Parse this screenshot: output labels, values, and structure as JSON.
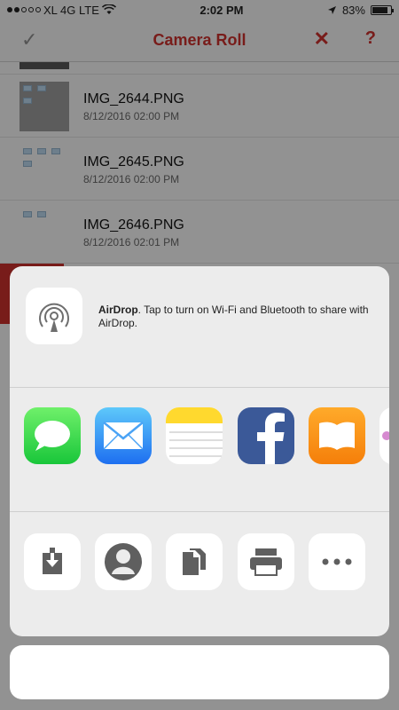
{
  "status_bar": {
    "carrier": "XL 4G LTE",
    "time": "2:02 PM",
    "battery": "83%",
    "battery_level": 0.83
  },
  "nav": {
    "title": "Camera Roll",
    "left_icon": "checkmark-icon",
    "close_icon": "close-icon",
    "help_label": "?"
  },
  "files": [
    {
      "name": "IMG_2644.PNG",
      "date": "8/12/2016 02:00 PM"
    },
    {
      "name": "IMG_2645.PNG",
      "date": "8/12/2016 02:00 PM"
    },
    {
      "name": "IMG_2646.PNG",
      "date": "8/12/2016 02:01 PM"
    }
  ],
  "share_sheet": {
    "airdrop": {
      "title": "AirDrop",
      "message": ". Tap to turn on Wi-Fi and Bluetooth to share with AirDrop."
    },
    "apps": [
      {
        "icon": "messages-icon",
        "color": "#25d04a"
      },
      {
        "icon": "mail-icon",
        "color": "#2a8ff2"
      },
      {
        "icon": "notes-icon",
        "color": "#ffd92e"
      },
      {
        "icon": "facebook-icon",
        "color": "#3b5998"
      },
      {
        "icon": "ibooks-icon",
        "color": "#f58a14"
      }
    ],
    "actions": [
      {
        "icon": "save-to-files-icon"
      },
      {
        "icon": "contact-icon"
      },
      {
        "icon": "copy-icon"
      },
      {
        "icon": "print-icon"
      },
      {
        "icon": "more-icon"
      }
    ]
  },
  "colors": {
    "accent": "#c9302c",
    "sheet_bg": "#ececec"
  }
}
